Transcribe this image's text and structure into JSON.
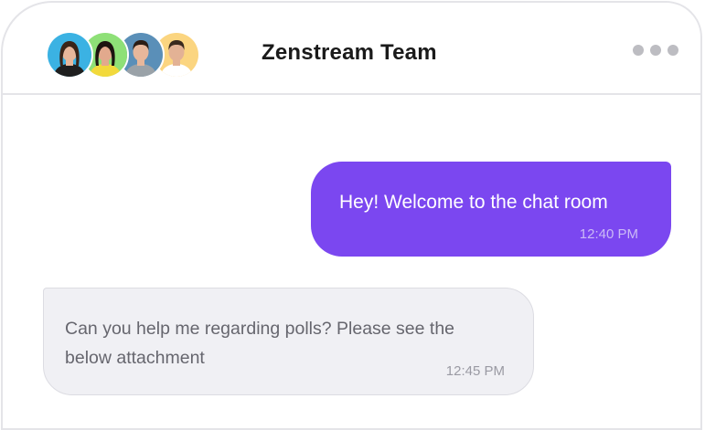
{
  "header": {
    "title": "Zenstream Team",
    "more_icon": "more-horizontal-icon",
    "avatars": [
      {
        "name": "avatar-1",
        "bg": "#3bb2e3",
        "hair": "#3a2418",
        "skin": "#e7b79b",
        "shirt": "#1f1f1f"
      },
      {
        "name": "avatar-2",
        "bg": "#8ee077",
        "hair": "#1c1410",
        "skin": "#e2a98d",
        "shirt": "#f2d93c"
      },
      {
        "name": "avatar-3",
        "bg": "#5a8fb8",
        "hair": "#2b1d15",
        "skin": "#e7b79b",
        "shirt": "#9aa2a8"
      },
      {
        "name": "avatar-4",
        "bg": "#fbd580",
        "hair": "#3a2a1e",
        "skin": "#e3b295",
        "shirt": "#ffffff"
      }
    ]
  },
  "messages": [
    {
      "direction": "out",
      "text": "Hey! Welcome to the chat room",
      "time": "12:40 PM"
    },
    {
      "direction": "in",
      "text": "Can you help me regarding polls? Please see the below attachment",
      "time": "12:45 PM"
    }
  ],
  "colors": {
    "accent": "#7b47f0",
    "incoming_bg": "#f0f0f4"
  }
}
